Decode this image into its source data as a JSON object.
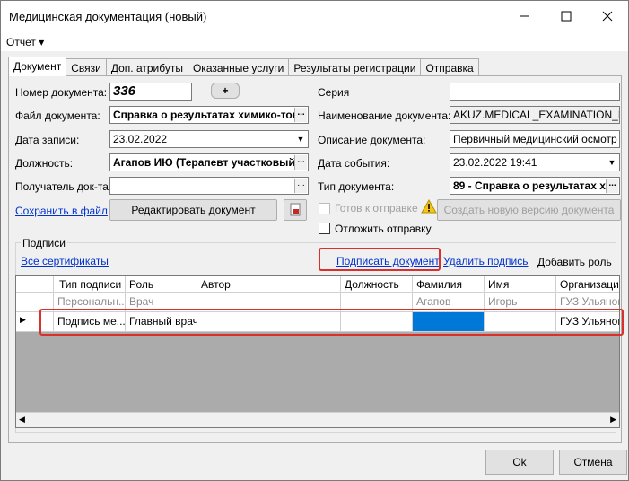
{
  "window": {
    "title": "Медицинская документация (новый)"
  },
  "menu": {
    "report": "Отчет"
  },
  "tabs": [
    "Документ",
    "Связи",
    "Доп. атрибуты",
    "Оказанные услуги",
    "Результаты регистрации",
    "Отправка"
  ],
  "form": {
    "doc_number_label": "Номер документа:",
    "doc_number": "336",
    "add_btn": "+",
    "doc_file_label": "Файл документа:",
    "doc_file": "Справка о результатах химико-ток",
    "record_date_label": "Дата записи:",
    "record_date": "23.02.2022",
    "position_label": "Должность:",
    "position": "Агапов ИЮ (Терапевт участковый)",
    "recipient_label": "Получатель док-та",
    "recipient": "",
    "save_link": "Сохранить в файл",
    "edit_btn": "Редактировать документ",
    "series_label": "Серия",
    "series": "",
    "doc_name_label": "Наименование документа:",
    "doc_name": "AKUZ.MEDICAL_EXAMINATION_MAIN",
    "doc_desc_label": "Описание документа:",
    "doc_desc": "Первичный медицинский осмотр",
    "event_date_label": "Дата события:",
    "event_date": "23.02.2022 19:41",
    "doc_type_label": "Тип документа:",
    "doc_type": "89 - Справка о результатах х...",
    "ready_label": "Готов к отправке",
    "new_version_btn": "Создать новую версию документа",
    "postpone_label": "Отложить отправку"
  },
  "signatures": {
    "group_label": "Подписи",
    "all_certs": "Все сертификаты",
    "sign_doc": "Подписать документ",
    "delete_sig": "Удалить подпись",
    "add_role": "Добавить роль",
    "columns": [
      "Тип подписи",
      "Роль",
      "Автор",
      "Должность",
      "Фамилия",
      "Имя",
      "Организация"
    ],
    "rows": [
      [
        "Персональн...",
        "Врач",
        "",
        "",
        "Агапов",
        "Игорь",
        "ГУЗ Ульянов"
      ],
      [
        "Подпись ме...",
        "Главный врач",
        "",
        "",
        "",
        "",
        "ГУЗ Ульянов"
      ]
    ]
  },
  "footer": {
    "ok": "Ok",
    "cancel": "Отмена"
  },
  "colors": {
    "highlight": "#d9302c",
    "selected_cell": "#0078d7",
    "link": "#0033cc"
  }
}
